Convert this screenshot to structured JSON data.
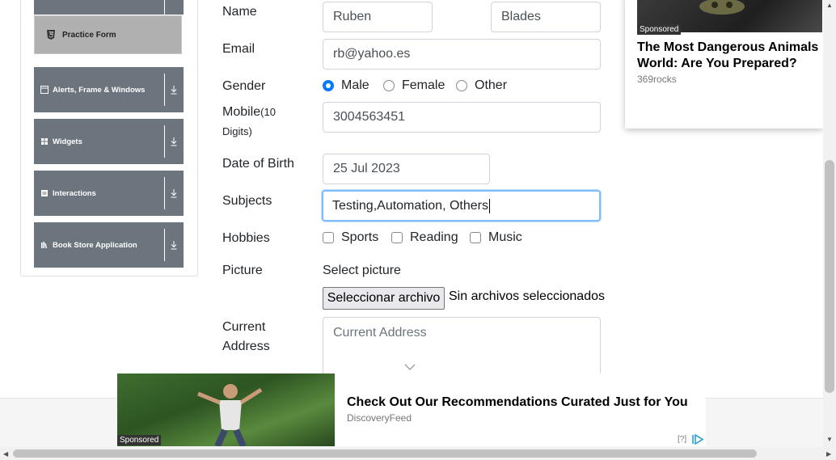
{
  "sidebar": {
    "active_item": "Practice Form",
    "groups": [
      {
        "label": "Alerts, Frame & Windows"
      },
      {
        "label": "Widgets"
      },
      {
        "label": "Interactions"
      },
      {
        "label": "Book Store Application"
      }
    ]
  },
  "form": {
    "name": {
      "label": "Name",
      "first": "Ruben",
      "last": "Blades"
    },
    "email": {
      "label": "Email",
      "value": "rb@yahoo.es"
    },
    "gender": {
      "label": "Gender",
      "options": [
        "Male",
        "Female",
        "Other"
      ],
      "selected": "Male"
    },
    "mobile": {
      "label": "Mobile",
      "hint_open": "(10",
      "hint_close": "Digits)",
      "value": "3004563451"
    },
    "dob": {
      "label": "Date of Birth",
      "value": "25 Jul 2023"
    },
    "subjects": {
      "label": "Subjects",
      "value": "Testing,Automation, Others"
    },
    "hobbies": {
      "label": "Hobbies",
      "options": [
        "Sports",
        "Reading",
        "Music"
      ]
    },
    "picture": {
      "label": "Picture",
      "prompt": "Select picture",
      "button": "Seleccionar archivo",
      "status": "Sin archivos seleccionados"
    },
    "address": {
      "label_line1": "Current",
      "label_line2": "Address",
      "placeholder": "Current Address"
    }
  },
  "ads": {
    "right": {
      "tag": "Sponsored",
      "title": "The Most Dangerous Animals World: Are You Prepared?",
      "source": "369rocks"
    },
    "bottom": {
      "tag": "Sponsored",
      "title": "Check Out Our Recommendations Curated Just for You",
      "source": "DiscoveryFeed",
      "help": "[?]"
    }
  }
}
